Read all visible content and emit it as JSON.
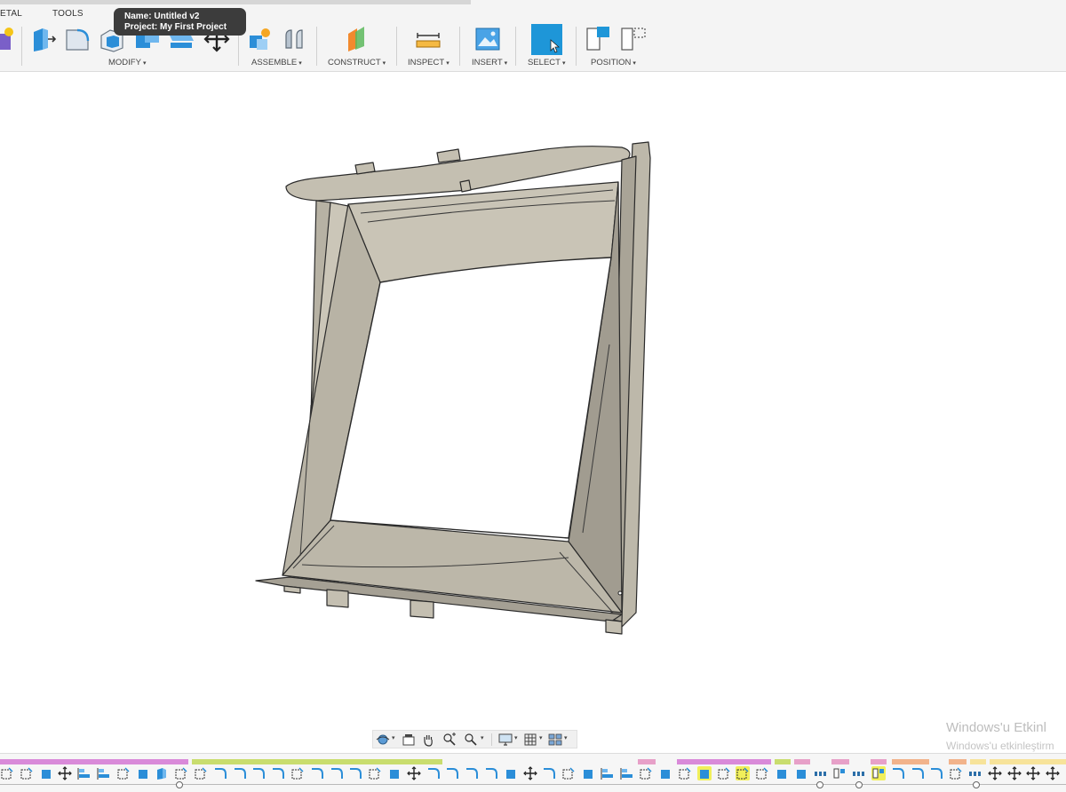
{
  "ribbon": {
    "tabs": [
      "ETAL",
      "TOOLS"
    ],
    "groups": [
      {
        "label": "MODIFY",
        "caret": "▾"
      },
      {
        "label": "ASSEMBLE",
        "caret": "▾"
      },
      {
        "label": "CONSTRUCT",
        "caret": "▾"
      },
      {
        "label": "INSPECT",
        "caret": "▾"
      },
      {
        "label": "INSERT",
        "caret": "▾"
      },
      {
        "label": "SELECT",
        "caret": "▾"
      },
      {
        "label": "POSITION",
        "caret": "▾"
      }
    ],
    "tools": [
      "create-sketch-icon",
      "press-pull-icon",
      "fillet-icon",
      "shell-icon",
      "combine-icon",
      "replace-face-icon",
      "move-icon",
      "new-component-icon",
      "joint-icon",
      "offset-plane-icon",
      "measure-icon",
      "insert-image-icon",
      "select-icon",
      "capture-position-icon",
      "revert-position-icon"
    ]
  },
  "tooltip": {
    "name_line": "Name: Untitled v2",
    "project_line": "Project: My First Project"
  },
  "navigation_bar": {
    "tools": [
      "orbit-icon",
      "look-at-icon",
      "pan-icon",
      "zoom-window-icon",
      "zoom-icon",
      "display-settings-icon",
      "grid-icon",
      "viewports-icon"
    ],
    "caret": "▾"
  },
  "watermark": {
    "line1": "Windows'u Etkinl",
    "line2": "Windows'u etkinleştirm"
  },
  "timeline": {
    "segment_colors": [
      "#d98ad9",
      "#d98ad9",
      "#c9dd6e",
      "#c9dd6e",
      "#e7a0c8",
      "#e7a0c8",
      "#f2b38b",
      "#f7e39a",
      "#e7a0c8"
    ],
    "highlight_color": "#f1ef5a",
    "feature_icons": [
      "extrude-icon",
      "sketch-icon",
      "body-icon",
      "move-icon",
      "align-icon",
      "fillet-icon",
      "sketch-icon",
      "pattern-icon",
      "mirror-icon",
      "press-pull-icon"
    ]
  },
  "model": {
    "color": "#c3beb0",
    "shade": "#9e9a8e",
    "edge": "#2a2a2a"
  }
}
